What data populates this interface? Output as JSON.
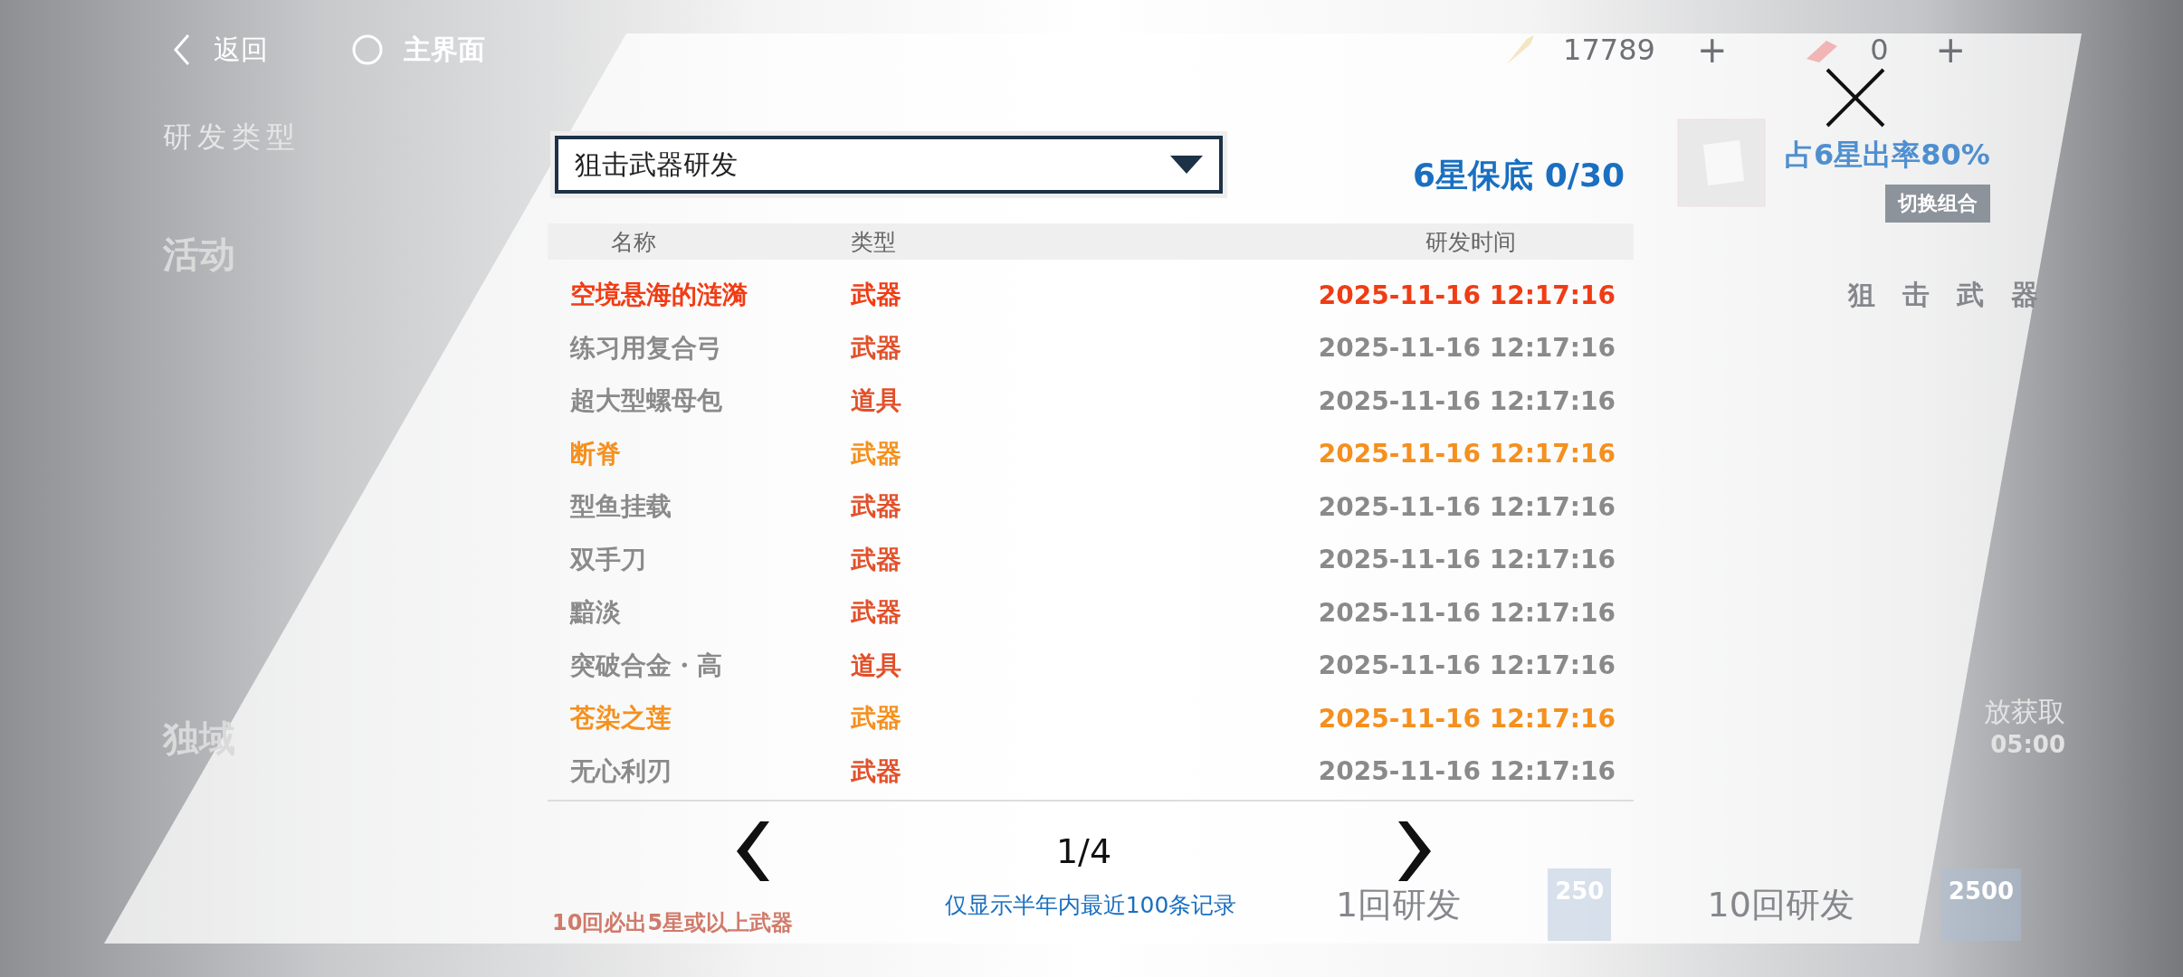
{
  "top_bar": {
    "back": "返回",
    "home": "主界面",
    "currencies": [
      {
        "amount": "17789",
        "add": "+"
      },
      {
        "amount": "0",
        "add": "+"
      }
    ]
  },
  "background": {
    "left": {
      "title": "研发类型",
      "items": [
        "活动",
        "独域"
      ]
    },
    "right": {
      "rate": "占6星出率80%",
      "switch": "切换组合",
      "banner_title": "狙击武器",
      "status": "放获取",
      "time": "05:00"
    },
    "bottom": {
      "note": "10回必出5星或以上武器",
      "actions": [
        {
          "label": "1回研发",
          "cost": "250"
        },
        {
          "label": "10回研发",
          "cost": "2500"
        }
      ]
    }
  },
  "dialog": {
    "dropdown": {
      "value": "狙击武器研发"
    },
    "pity": "6星保底 0/30",
    "columns": [
      "名称",
      "类型",
      "研发时间"
    ],
    "rows": [
      {
        "name": "空境悬海的涟漪",
        "type": "武器",
        "time": "2025-11-16 12:17:16",
        "color": "#f03c14"
      },
      {
        "name": "练习用复合弓",
        "type": "武器",
        "time": "2025-11-16 12:17:16",
        "color": "#8a8a8a"
      },
      {
        "name": "超大型螺母包",
        "type": "道具",
        "time": "2025-11-16 12:17:16",
        "color": "#8a8a8a"
      },
      {
        "name": "断脊",
        "type": "武器",
        "time": "2025-11-16 12:17:16",
        "color": "#f5901e"
      },
      {
        "name": "型鱼挂载",
        "type": "武器",
        "time": "2025-11-16 12:17:16",
        "color": "#8a8a8a"
      },
      {
        "name": "双手刀",
        "type": "武器",
        "time": "2025-11-16 12:17:16",
        "color": "#8a8a8a"
      },
      {
        "name": "黯淡",
        "type": "武器",
        "time": "2025-11-16 12:17:16",
        "color": "#8a8a8a"
      },
      {
        "name": "突破合金・高",
        "type": "道具",
        "time": "2025-11-16 12:17:16",
        "color": "#8a8a8a"
      },
      {
        "name": "苍染之莲",
        "type": "武器",
        "time": "2025-11-16 12:17:16",
        "color": "#f5901e"
      },
      {
        "name": "无心利刃",
        "type": "武器",
        "time": "2025-11-16 12:17:16",
        "color": "#8a8a8a"
      }
    ],
    "page": "1/4",
    "note": "仅显示半年内最近100条记录"
  }
}
